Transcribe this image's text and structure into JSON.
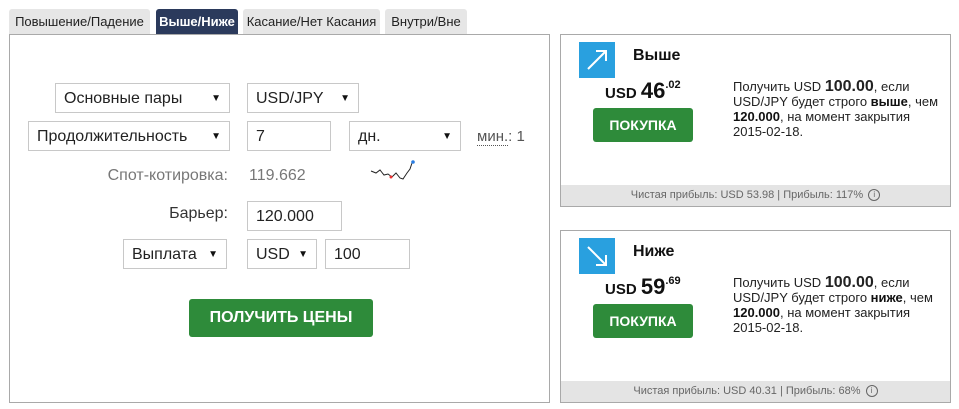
{
  "tabs": [
    {
      "label": "Повышение/Падение"
    },
    {
      "label": "Выше/Ниже"
    },
    {
      "label": "Касание/Нет Касания"
    },
    {
      "label": "Внутри/Вне"
    }
  ],
  "form": {
    "market": "Основные пары",
    "underlying": "USD/JPY",
    "duration_type": "Продолжительность",
    "duration_value": "7",
    "duration_unit": "дн.",
    "min_label": "мин.",
    "min_sep": ":",
    "min_value": "1",
    "spot_label": "Спот-котировка:",
    "spot_value": "119.662",
    "barrier_label": "Барьер:",
    "barrier_value": "120.000",
    "payout_type": "Выплата",
    "currency": "USD",
    "amount": "100",
    "get_prices": "ПОЛУЧИТЬ ЦЕНЫ"
  },
  "contracts": {
    "higher": {
      "title": "Выше",
      "currency": "USD",
      "price_int": "46",
      "price_dec": ".02",
      "buy_label": "ПОКУПКА",
      "desc_pre": "Получить USD ",
      "desc_amount": "100.00",
      "desc_mid": ", если USD/JPY будет строго ",
      "desc_dir": "выше",
      "desc_mid2": ", чем ",
      "desc_barrier": "120.000",
      "desc_post": ", на момент закрытия 2015-02-18.",
      "footer": "Чистая прибыль: USD 53.98 | Прибыль: 117%"
    },
    "lower": {
      "title": "Ниже",
      "currency": "USD",
      "price_int": "59",
      "price_dec": ".69",
      "buy_label": "ПОКУПКА",
      "desc_pre": "Получить USD ",
      "desc_amount": "100.00",
      "desc_mid": ", если USD/JPY будет строго ",
      "desc_dir": "ниже",
      "desc_mid2": ", чем ",
      "desc_barrier": "120.000",
      "desc_post": ", на момент закрытия 2015-02-18.",
      "footer": "Чистая прибыль: USD 40.31 | Прибыль: 68%"
    }
  },
  "icons": {
    "caret": "▼",
    "info": "i",
    "higher_arrow": "arrow-up-right-icon",
    "lower_arrow": "arrow-down-right-icon",
    "sparkline": "sparkline-icon"
  },
  "colors": {
    "tab_active": "#2b3a5c",
    "button_green": "#2e8b3a",
    "icon_blue": "#29a0df"
  }
}
